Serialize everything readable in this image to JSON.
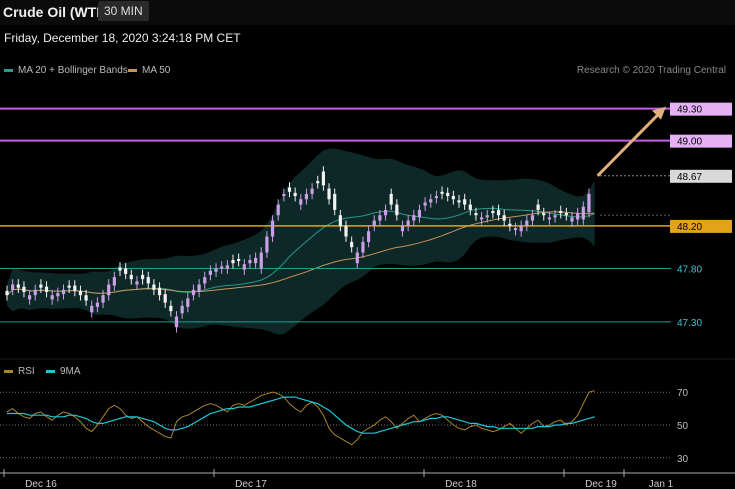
{
  "header": {
    "title": "Crude Oil (WTI)",
    "timeframe": "30 MIN"
  },
  "datetime": "Friday, December 18, 2020 3:24:18 PM CET",
  "research": "Research © 2020 Trading Central",
  "colors": {
    "background": "#000000",
    "up_candle": "#c9a0e6",
    "down_candle": "#f2f2f2",
    "bb_band": "#0f2b2b",
    "ma20": "#2a9a8c",
    "ma50": "#c9935a",
    "resistance": "#c85ce8",
    "pivot": "#e3a21a",
    "support": "#2a9a8c",
    "rsi": "#a8862e",
    "rsi_ma": "#19c9d8",
    "arrow": "#dfb07a"
  },
  "chart_data": [
    {
      "type": "candlestick",
      "title": "Crude Oil (WTI)",
      "timeframe": "30 MIN",
      "legend": [
        {
          "name": "MA 20 + Bollinger Bands",
          "color": "#2a9a8c"
        },
        {
          "name": "MA 50",
          "color": "#c9935a"
        }
      ],
      "legend_position": "top-left",
      "x_tick_labels": [
        "Dec 16",
        "Dec 17",
        "Dec 18",
        "Dec 19",
        "Jan 1"
      ],
      "ylim": [
        46.97,
        49.55
      ],
      "levels": [
        {
          "label": "49.30",
          "value": 49.3,
          "style": "resistance"
        },
        {
          "label": "49.00",
          "value": 49.0,
          "style": "resistance"
        },
        {
          "label": "48.67",
          "value": 48.67,
          "style": "current"
        },
        {
          "label": "48.20",
          "value": 48.2,
          "style": "pivot"
        },
        {
          "label": "47.80",
          "value": 47.8,
          "style": "support"
        },
        {
          "label": "47.30",
          "value": 47.3,
          "style": "support"
        }
      ],
      "arrow": {
        "from": 48.67,
        "to": 49.3
      },
      "close": [
        47.55,
        47.65,
        47.62,
        47.58,
        47.55,
        47.6,
        47.62,
        47.58,
        47.55,
        47.57,
        47.6,
        47.62,
        47.59,
        47.55,
        47.5,
        47.45,
        47.48,
        47.55,
        47.65,
        47.72,
        47.78,
        47.75,
        47.7,
        47.68,
        47.7,
        47.66,
        47.6,
        47.55,
        47.48,
        47.4,
        47.35,
        47.45,
        47.52,
        47.6,
        47.65,
        47.72,
        47.78,
        47.8,
        47.82,
        47.83,
        47.85,
        47.87,
        47.84,
        47.88,
        47.9,
        47.95,
        48.1,
        48.25,
        48.4,
        48.5,
        48.52,
        48.48,
        48.45,
        48.5,
        48.55,
        48.6,
        48.58,
        48.45,
        48.35,
        48.2,
        48.1,
        48.0,
        47.95,
        48.05,
        48.15,
        48.25,
        48.3,
        48.35,
        48.4,
        48.3,
        48.2,
        48.25,
        48.3,
        48.35,
        48.42,
        48.45,
        48.48,
        48.5,
        48.48,
        48.45,
        48.42,
        48.4,
        48.35,
        48.3,
        48.28,
        48.3,
        48.32,
        48.3,
        48.25,
        48.2,
        48.18,
        48.2,
        48.25,
        48.3,
        48.35,
        48.3,
        48.28,
        48.3,
        48.32,
        48.3,
        48.28,
        48.32,
        48.38,
        48.5,
        48.67
      ],
      "open_offset": [
        -0.04,
        0.05,
        -0.03,
        -0.05,
        0.04,
        0.05,
        -0.03,
        -0.05,
        0.04,
        0.03,
        0.04,
        -0.02,
        -0.05,
        -0.04,
        -0.05,
        0.06,
        0.04,
        0.07,
        0.1,
        0.08,
        -0.03,
        -0.05,
        -0.04,
        0.03,
        -0.04,
        -0.06,
        -0.05,
        -0.07,
        -0.08,
        -0.05,
        0.1,
        0.07,
        0.08,
        0.05,
        0.07,
        0.06,
        0.04,
        0.03,
        0.02,
        0.03,
        -0.03,
        -0.02,
        0.05,
        0.03,
        0.05,
        0.15,
        0.15,
        0.15,
        0.1,
        0.02,
        -0.04,
        -0.03,
        0.05,
        0.05,
        0.05,
        -0.02,
        -0.13,
        -0.1,
        -0.15,
        -0.1,
        -0.1,
        -0.05,
        0.1,
        0.1,
        0.1,
        0.05,
        0.05,
        0.05,
        -0.1,
        -0.1,
        0.05,
        0.05,
        0.05,
        0.07,
        0.03,
        0.03,
        0.02,
        -0.02,
        -0.03,
        -0.03,
        -0.02,
        -0.05,
        -0.05,
        -0.02,
        0.02,
        0.02,
        -0.02,
        -0.05,
        -0.05,
        -0.02,
        0.02,
        0.05,
        0.05,
        0.05,
        -0.05,
        -0.02,
        0.02,
        0.02,
        -0.02,
        -0.02,
        0.04,
        0.06,
        0.12,
        0.17
      ]
    },
    {
      "type": "line",
      "series": [
        {
          "name": "RSI"
        },
        {
          "name": "9MA"
        }
      ],
      "legend_position": "top-left",
      "ylim": [
        25,
        75
      ],
      "y_tick_labels": [
        "70",
        "50",
        "30"
      ],
      "rsi": [
        58,
        60,
        57,
        55,
        54,
        57,
        58,
        55,
        53,
        56,
        58,
        57,
        55,
        52,
        48,
        46,
        50,
        55,
        60,
        62,
        60,
        56,
        54,
        55,
        52,
        49,
        47,
        45,
        43,
        42,
        52,
        55,
        56,
        58,
        60,
        62,
        63,
        62,
        60,
        58,
        62,
        63,
        62,
        64,
        66,
        68,
        69,
        70,
        69,
        67,
        63,
        60,
        58,
        62,
        64,
        61,
        56,
        48,
        44,
        42,
        40,
        38,
        41,
        46,
        48,
        50,
        53,
        55,
        52,
        48,
        51,
        54,
        56,
        52,
        54,
        56,
        57,
        56,
        53,
        50,
        48,
        47,
        49,
        50,
        48,
        47,
        46,
        47,
        49,
        51,
        48,
        45,
        48,
        51,
        53,
        49,
        50,
        52,
        53,
        50,
        52,
        56,
        63,
        70,
        71
      ],
      "rsi_ma": [
        57,
        57,
        57,
        57,
        56,
        56,
        56,
        56,
        55,
        55,
        55,
        56,
        56,
        55,
        54,
        52,
        51,
        51,
        52,
        53,
        54,
        55,
        55,
        55,
        54,
        53,
        52,
        50,
        48,
        47,
        47,
        48,
        49,
        51,
        53,
        55,
        57,
        58,
        59,
        60,
        60,
        61,
        61,
        61,
        62,
        63,
        64,
        65,
        66,
        67,
        67,
        67,
        66,
        65,
        64,
        63,
        61,
        59,
        56,
        53,
        50,
        48,
        46,
        45,
        45,
        45,
        46,
        47,
        48,
        49,
        50,
        51,
        52,
        52,
        53,
        54,
        54,
        55,
        55,
        54,
        53,
        52,
        51,
        51,
        50,
        49,
        49,
        48,
        48,
        48,
        48,
        48,
        48,
        48,
        49,
        49,
        49,
        50,
        50,
        51,
        51,
        52,
        53,
        54,
        55
      ]
    }
  ]
}
